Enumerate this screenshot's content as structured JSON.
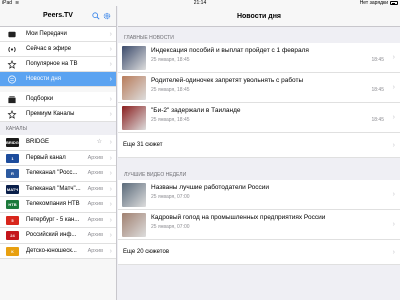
{
  "status": {
    "device": "iPad",
    "time": "21:14",
    "battery_label": "Нет зарядки"
  },
  "sidebar": {
    "title": "Peers.TV",
    "menu": [
      {
        "label": "Мои Передачи",
        "icon": "tv-icon"
      },
      {
        "label": "Сейчас в эфире",
        "icon": "broadcast-icon"
      },
      {
        "label": "Популярное на ТВ",
        "icon": "star-outline-icon"
      },
      {
        "label": "Новости дня",
        "icon": "news-icon",
        "selected": true
      }
    ],
    "menu2": [
      {
        "label": "Подборки",
        "icon": "collection-icon"
      },
      {
        "label": "Премиум Каналы",
        "icon": "star-outline-icon"
      }
    ],
    "channels_label": "КАНАЛЫ",
    "channels": [
      {
        "name": "BRIDGE",
        "logo": "BRIDGE",
        "star": "☆",
        "logo_color": "#1a1a1a"
      },
      {
        "name": "Первый канал",
        "logo": "1",
        "archive": "Архив",
        "logo_color": "#1d4c9c"
      },
      {
        "name": "Телеканал \"Росс...",
        "logo": "R",
        "archive": "Архив",
        "logo_color": "#2c5aa0"
      },
      {
        "name": "Телеканал \"Матч\"...",
        "logo": "МАТЧ",
        "archive": "Архив",
        "logo_color": "#0a1f4a"
      },
      {
        "name": "Телекомпания НТВ",
        "logo": "НТВ",
        "archive": "Архив",
        "logo_color": "#1c7a3b"
      },
      {
        "name": "Петербург - 5 кан...",
        "logo": "5",
        "archive": "Архив",
        "logo_color": "#d8261c"
      },
      {
        "name": "Российский инф...",
        "logo": "24",
        "archive": "Архив",
        "logo_color": "#c4161c"
      },
      {
        "name": "Детско-юношеск...",
        "logo": "К",
        "archive": "Архив",
        "logo_color": "#e8a010"
      }
    ]
  },
  "main": {
    "title": "Новости дня",
    "sections": [
      {
        "label": "ГЛАВНЫЕ НОВОСТИ",
        "items": [
          {
            "headline": "Индексация пособий и выплат пройдет с 1 февраля",
            "date": "25 января, 18:45",
            "time": "18:45",
            "thumb": "#3b4a6b"
          },
          {
            "headline": "Родителей-одиночек запретят увольнять с работы",
            "date": "25 января, 18:45",
            "time": "18:45",
            "thumb": "#b87c5a"
          },
          {
            "headline": "\"Би-2\" задержали в Таиланде",
            "date": "25 января, 18:45",
            "time": "18:45",
            "thumb": "#8a1e1e"
          }
        ],
        "more": "Еще 31 сюжет"
      },
      {
        "label": "ЛУЧШИЕ ВИДЕО НЕДЕЛИ",
        "items": [
          {
            "headline": "Названы лучшие работодатели России",
            "date": "25 января, 07:00",
            "time": "",
            "thumb": "#5a6a7a"
          },
          {
            "headline": "Кадровый голод на промышленных предприятиях России",
            "date": "25 января, 07:00",
            "time": "",
            "thumb": "#a08070"
          }
        ],
        "more": "Еще 20 сюжетов"
      }
    ]
  },
  "colors": {
    "accent": "#5ba3f1",
    "icon_blue": "#2b7de9"
  }
}
